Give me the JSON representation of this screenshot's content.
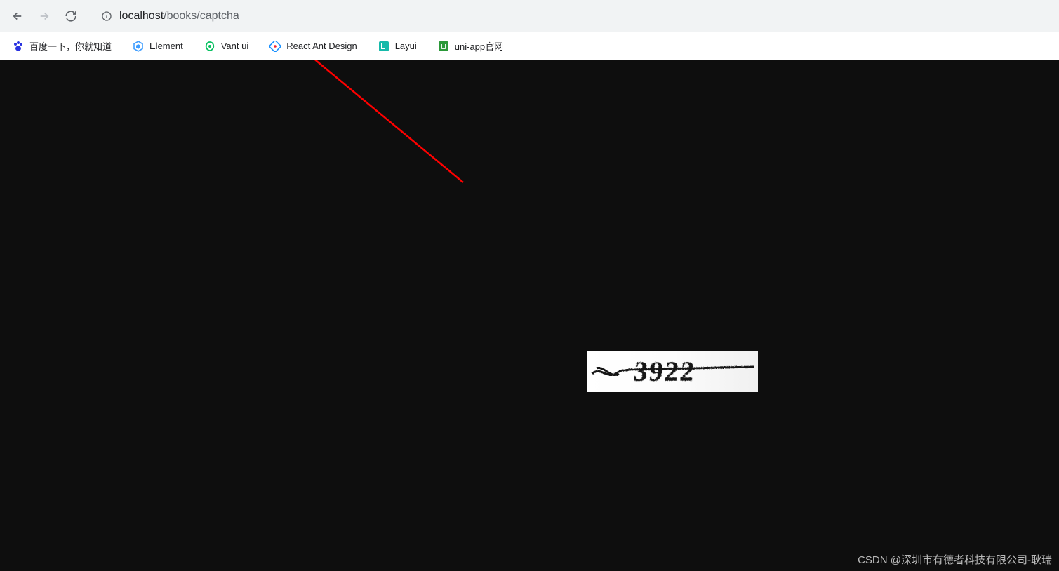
{
  "url": {
    "host": "localhost",
    "path": "/books/captcha"
  },
  "bookmarks": [
    {
      "label": "百度一下，你就知道",
      "icon": "baidu"
    },
    {
      "label": "Element",
      "icon": "element"
    },
    {
      "label": "Vant ui",
      "icon": "vant"
    },
    {
      "label": "React Ant Design",
      "icon": "antd"
    },
    {
      "label": "Layui",
      "icon": "layui"
    },
    {
      "label": "uni-app官网",
      "icon": "uniapp"
    }
  ],
  "captcha": {
    "value": "3922"
  },
  "watermark": "CSDN @深圳市有德者科技有限公司-耿瑞"
}
